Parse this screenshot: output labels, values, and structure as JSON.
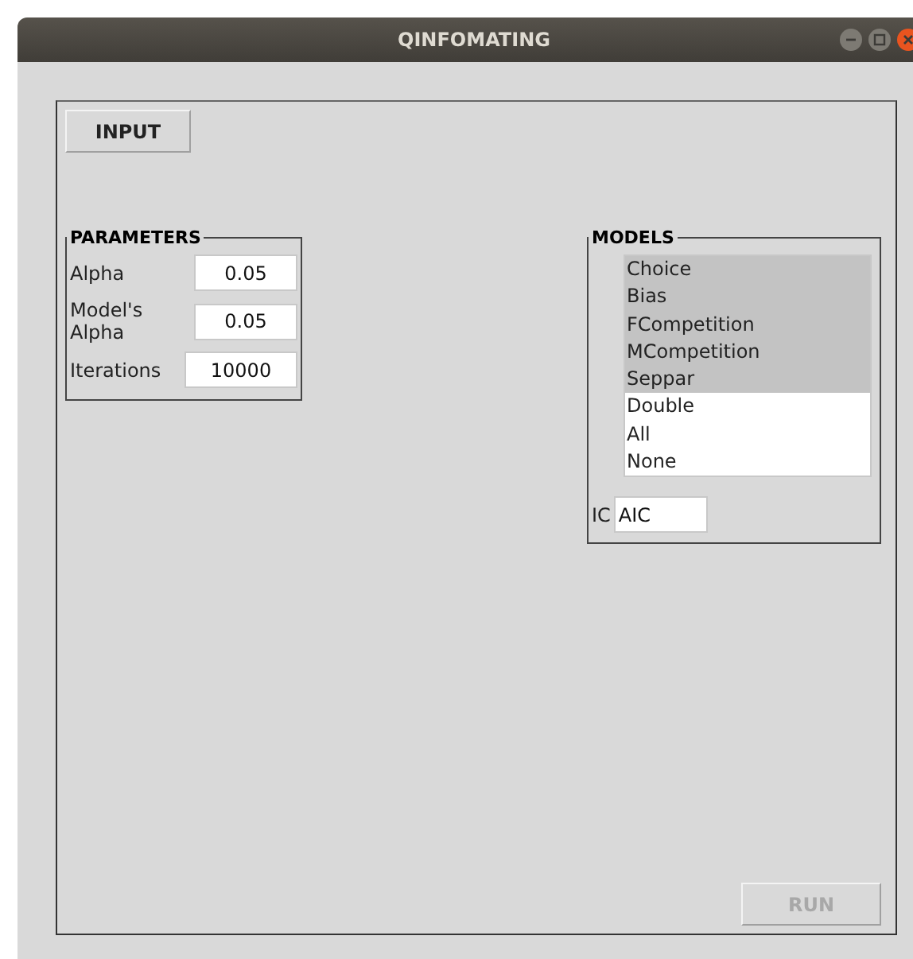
{
  "window": {
    "title": "QINFOMATING"
  },
  "input_button": {
    "label": "INPUT"
  },
  "parameters": {
    "title": "PARAMETERS",
    "fields": [
      {
        "label": "Alpha",
        "value": "0.05"
      },
      {
        "label": "Model's Alpha",
        "value": "0.05"
      },
      {
        "label": "Iterations",
        "value": "10000"
      }
    ]
  },
  "models": {
    "title": "MODELS",
    "items": [
      {
        "label": "Choice",
        "selected": true
      },
      {
        "label": "Bias",
        "selected": true
      },
      {
        "label": "FCompetition",
        "selected": true
      },
      {
        "label": "MCompetition",
        "selected": true
      },
      {
        "label": "Seppar",
        "selected": true
      },
      {
        "label": "Double",
        "selected": false
      },
      {
        "label": "All",
        "selected": false
      },
      {
        "label": "None",
        "selected": false
      }
    ],
    "ic": {
      "label": "IC",
      "value": "AIC"
    }
  },
  "run_button": {
    "label": "RUN",
    "disabled": true
  }
}
